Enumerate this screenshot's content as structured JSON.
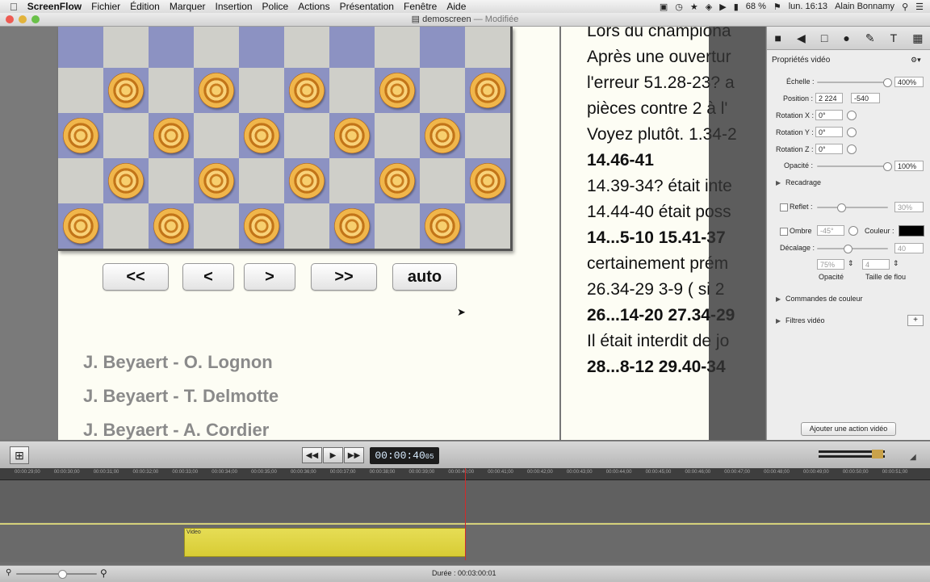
{
  "menubar": {
    "app": "ScreenFlow",
    "menus": [
      "Fichier",
      "Édition",
      "Marquer",
      "Insertion",
      "Police",
      "Actions",
      "Présentation",
      "Fenêtre",
      "Aide"
    ],
    "battery": "68 %",
    "clock": "lun. 16:13",
    "user": "Alain Bonnamy"
  },
  "window": {
    "title": "demoscreen",
    "status": "— Modifiée"
  },
  "canvas": {
    "nav_buttons": [
      "<<",
      "<",
      ">",
      ">>",
      "auto"
    ],
    "games": [
      "J. Beyaert - O. Lognon",
      "J. Beyaert - T. Delmotte",
      "J. Beyaert - A. Cordier"
    ],
    "notes": [
      {
        "text": "Lors du championa",
        "bold": false
      },
      {
        "text": "Après une ouvertur",
        "bold": false
      },
      {
        "text": "l'erreur 51.28-23? a",
        "bold": false
      },
      {
        "text": "pièces contre 2 à l'",
        "bold": false
      },
      {
        "text": "Voyez plutôt. 1.34-2",
        "bold": false
      },
      {
        "text": "14.46-41",
        "bold": true
      },
      {
        "text": "14.39-34? était inte",
        "bold": false
      },
      {
        "text": "14.44-40 était poss",
        "bold": false
      },
      {
        "text": "14...5-10 15.41-37",
        "bold": true
      },
      {
        "text": "certainement prém",
        "bold": false
      },
      {
        "text": "26.34-29 3-9 ( si 2",
        "bold": false
      },
      {
        "text": "26...14-20 27.34-29",
        "bold": true
      },
      {
        "text": "Il était interdit de jo",
        "bold": false
      },
      {
        "text": "28...8-12 29.40-34",
        "bold": true
      }
    ]
  },
  "inspector": {
    "title": "Propriétés vidéo",
    "scale_label": "Échelle :",
    "scale_value": "400%",
    "position_label": "Position :",
    "position_x": "2 224",
    "position_y": "-540",
    "rotation_x_label": "Rotation X :",
    "rotation_x": "0°",
    "rotation_y_label": "Rotation Y :",
    "rotation_y": "0°",
    "rotation_z_label": "Rotation Z :",
    "rotation_z": "0°",
    "opacity_label": "Opacité :",
    "opacity_value": "100%",
    "crop_label": "Recadrage",
    "reflection_label": "Reflet :",
    "reflection_value": "30%",
    "shadow_label": "Ombre",
    "shadow_angle": "-45°",
    "color_label": "Couleur :",
    "offset_label": "Décalage :",
    "offset_value": "40",
    "shadow_opacity": "75%",
    "blur_size": "4",
    "shadow_opacity_label": "Opacité",
    "blur_size_label": "Taille de flou",
    "color_controls_label": "Commandes de couleur",
    "video_filters_label": "Filtres vidéo",
    "add_action_button": "Ajouter une action vidéo",
    "scale_level": 1.0,
    "opacity_level": 1.0,
    "reflection_level": 0.3,
    "offset_level": 0.4
  },
  "transport": {
    "timecode": "00:00:40",
    "frames": "05"
  },
  "timeline": {
    "ticks": [
      "00:00:29;00",
      "00:00:30;00",
      "00:00:31;00",
      "00:00:32;00",
      "00:00:33;00",
      "00:00:34;00",
      "00:00:35;00",
      "00:00:36;00",
      "00:00:37;00",
      "00:00:38;00",
      "00:00:39;00",
      "00:00:40;00",
      "00:00:41;00",
      "00:00:42;00",
      "00:00:43;00",
      "00:00:44;00",
      "00:00:45;00",
      "00:00:46;00",
      "00:00:47;00",
      "00:00:48;00",
      "00:00:49;00",
      "00:00:50;00",
      "00:00:51;00"
    ],
    "clip_label": "Video",
    "duration": "Durée : 00:03:00:01"
  },
  "colors": {
    "board_dark": "#8c92c2",
    "board_light": "#cfcfc9",
    "clip": "#e6dd55",
    "playhead": "#d12a2a"
  }
}
